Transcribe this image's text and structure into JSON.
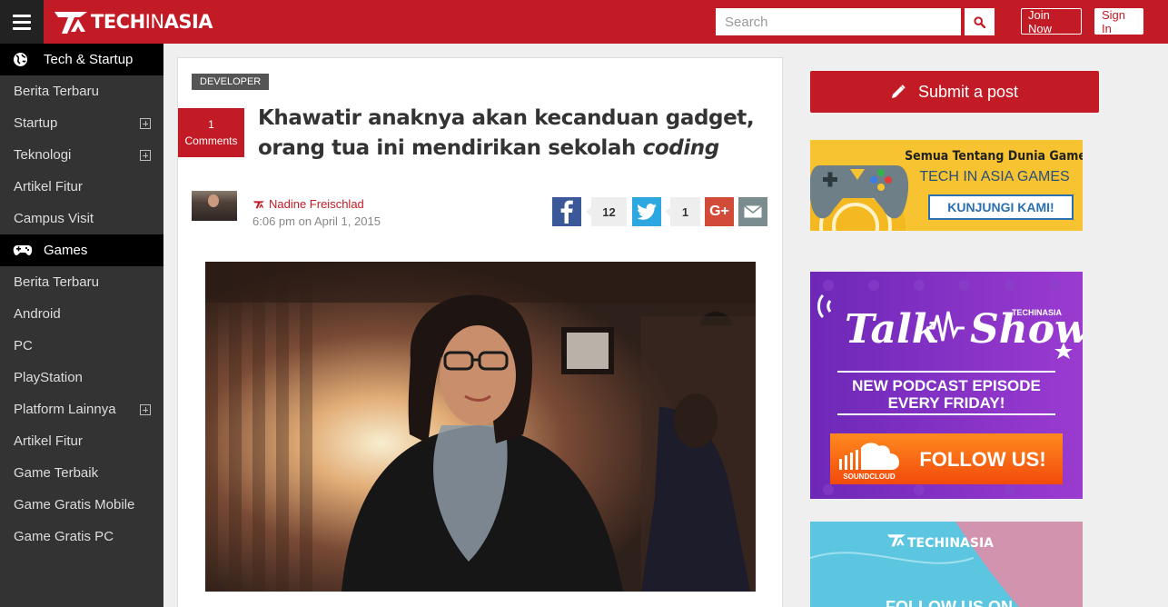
{
  "header": {
    "brand_bold": "TECH",
    "brand_thin": "IN",
    "brand_tail": "ASIA",
    "search_placeholder": "Search",
    "join_label": "Join Now",
    "signin_label": "Sign In",
    "accent_color": "#c31b25"
  },
  "sidebar": {
    "sections": [
      {
        "title": "Tech & Startup",
        "icon": "globe-icon",
        "items": [
          {
            "label": "Berita Terbaru",
            "expandable": false
          },
          {
            "label": "Startup",
            "expandable": true
          },
          {
            "label": "Teknologi",
            "expandable": true
          },
          {
            "label": "Artikel Fitur",
            "expandable": false
          },
          {
            "label": "Campus Visit",
            "expandable": false
          }
        ]
      },
      {
        "title": "Games",
        "icon": "gamepad-icon",
        "items": [
          {
            "label": "Berita Terbaru",
            "expandable": false
          },
          {
            "label": "Android",
            "expandable": false
          },
          {
            "label": "PC",
            "expandable": false
          },
          {
            "label": "PlayStation",
            "expandable": false
          },
          {
            "label": "Platform Lainnya",
            "expandable": true
          },
          {
            "label": "Artikel Fitur",
            "expandable": false
          },
          {
            "label": "Game Terbaik",
            "expandable": false
          },
          {
            "label": "Game Gratis Mobile",
            "expandable": false
          },
          {
            "label": "Game Gratis PC",
            "expandable": false
          }
        ]
      }
    ]
  },
  "article": {
    "category": "DEVELOPER",
    "comments_count": "1",
    "comments_label": "Comments",
    "title_line1": "Khawatir anaknya akan kecanduan gadget,",
    "title_line2_plain": "orang tua ini mendirikan sekolah ",
    "title_line2_em": "coding",
    "author": "Nadine Freischlad",
    "date": "6:06 pm on April 1, 2015",
    "facebook_count": "12",
    "twitter_count": "1",
    "gplus_label": "G+"
  },
  "sidebar_right": {
    "submit_label": "Submit a post",
    "games_ad": {
      "headline": "Semua Tentang Dunia Game",
      "brand": "TECH IN ASIA GAMES",
      "cta": "KUNJUNGI KAMI!"
    },
    "talk_ad": {
      "title_a": "Talk",
      "title_b": "Show",
      "brand_small": "TECHINASIA",
      "line1": "NEW PODCAST EPISODE",
      "line2": "EVERY FRIDAY!",
      "soundcloud": "SOUNDCLOUD",
      "cta": "FOLLOW US!"
    },
    "follow_ad": {
      "brand": "TECHINASIA",
      "partial": "FOLLOW US ON"
    }
  }
}
